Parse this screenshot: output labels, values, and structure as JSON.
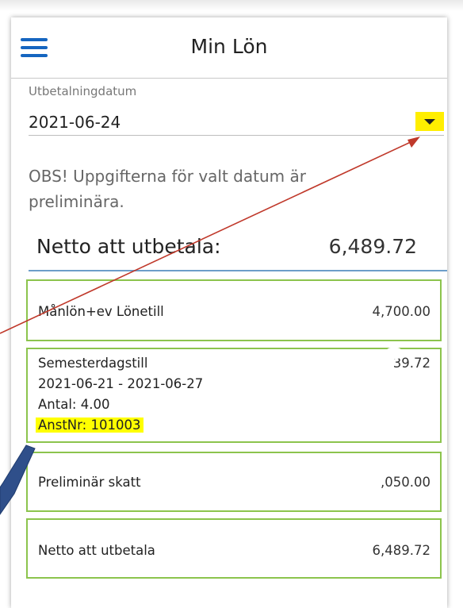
{
  "app": {
    "title": "Min Lön"
  },
  "date_picker": {
    "label": "Utbetalningdatum",
    "value": "2021-06-24"
  },
  "notice": "OBS! Uppgifterna för valt datum är preliminära.",
  "netto_header": {
    "label": "Netto att utbetala:",
    "value": "6,489.72"
  },
  "items": [
    {
      "label": "Månlön+ev Lönetill",
      "amount": "4,700.00"
    },
    {
      "label": "Semesterdagstill",
      "amount": "39.72",
      "period": "2021-06-21 - 2021-06-27",
      "antal": "Antal: 4.00",
      "anstnr": "AnstNr: 101003"
    },
    {
      "label": "Preliminär skatt",
      "amount": ",050.00"
    },
    {
      "label": "Netto att utbetala",
      "amount": "6,489.72"
    }
  ],
  "colors": {
    "accent": "#1565c0",
    "card_border": "#8cc44d",
    "highlight": "#ffff00",
    "annotation_arrow": "#c0392b",
    "callout_arrow": "#2f4f8a"
  }
}
